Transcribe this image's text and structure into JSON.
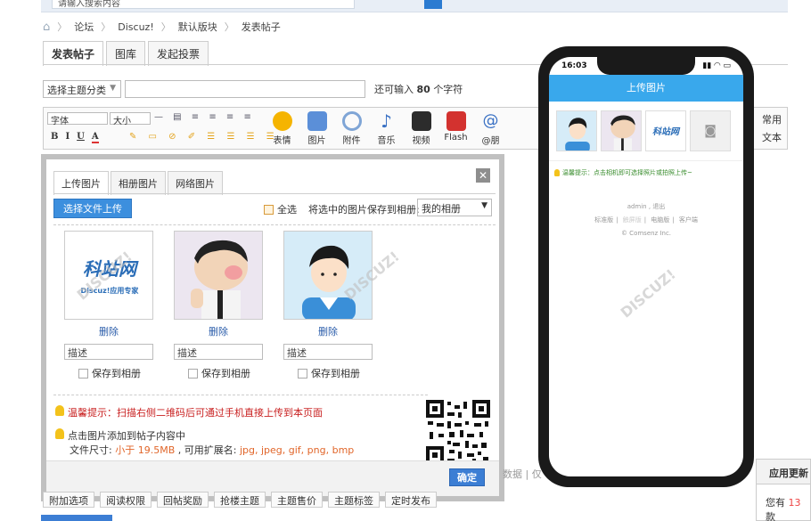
{
  "topbar": {
    "search_placeholder": "请输入搜索内容"
  },
  "breadcrumb": [
    "论坛",
    "Discuz!",
    "默认版块",
    "发表帖子"
  ],
  "tabs": [
    "发表帖子",
    "图库",
    "发起投票"
  ],
  "subject": {
    "category": "选择主题分类",
    "remain_prefix": "还可输入",
    "remain_count": "80",
    "remain_suffix": "个字符"
  },
  "editor": {
    "font": "字体",
    "size": "大小",
    "format_btns": [
      "B",
      "I",
      "U",
      "A"
    ],
    "big_buttons": [
      {
        "label": "表情",
        "color": "#f5b400"
      },
      {
        "label": "图片",
        "color": "#5b8fd8"
      },
      {
        "label": "附件",
        "color": "#7fa5d6"
      },
      {
        "label": "音乐",
        "color": "#3a71c4"
      },
      {
        "label": "视频",
        "color": "#2c2c2c"
      },
      {
        "label": "Flash",
        "color": "#d3322f"
      },
      {
        "label": "@朋",
        "color": "#3a71c4"
      }
    ],
    "right_top": "常用",
    "right_bottom": "文本"
  },
  "modal": {
    "tabs": [
      "上传图片",
      "相册图片",
      "网络图片"
    ],
    "upload_button": "选择文件上传",
    "select_all": "全选",
    "save_selected": "将选中的图片保存到相册:",
    "album": "我的相册",
    "photos": [
      {
        "delete": "删除",
        "desc": "描述",
        "save": "保存到相册",
        "logo_text": "科站网",
        "logo_sub": "Discuz!应用专家"
      },
      {
        "delete": "删除",
        "desc": "描述",
        "save": "保存到相册"
      },
      {
        "delete": "删除",
        "desc": "描述",
        "save": "保存到相册"
      }
    ],
    "tip_scan": "温馨提示：扫描右侧二维码后可通过手机直接上传到本页面",
    "tip_click": "点击图片添加到帖子内容中",
    "size_label": "文件尺寸:",
    "size_value": "小于 19.5MB",
    "ext_label": ", 可用扩展名:",
    "ext_value": "jpg, jpeg, gif, png, bmp",
    "ok": "确定"
  },
  "phone": {
    "time": "16:03",
    "header": "上传图片",
    "tip": "温馨提示：点击相机即可选择照片或拍照上传~",
    "user": "admin",
    "logout": "退出",
    "nav": [
      "标准版",
      "触屏版",
      "电脑版",
      "客户端"
    ],
    "copyright": "© Comsenz Inc."
  },
  "bottom_bar": [
    "附加选项",
    "阅读权限",
    "回帖奖励",
    "抢楼主题",
    "主题售价",
    "主题标签",
    "定时发布"
  ],
  "side_hint": "数据 | 仅",
  "update_panel": {
    "title": "应用更新",
    "line_prefix": "您有",
    "count": "13",
    "line_suffix": "款"
  },
  "colors": {
    "accent": "#3c8fde",
    "phone_header": "#39a8ec",
    "warn": "#c81e1e"
  }
}
